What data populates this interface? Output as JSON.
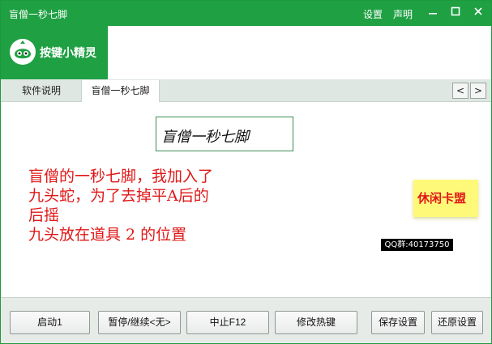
{
  "window": {
    "title": "盲僧一秒七脚",
    "links": {
      "settings": "设置",
      "statement": "声明"
    },
    "controls": {
      "minimize": "—",
      "maximize": "☐",
      "close": "✕"
    }
  },
  "brand": {
    "name": "按键小精灵",
    "color": "#1fa043"
  },
  "tabs": [
    {
      "label": "软件说明",
      "active": false
    },
    {
      "label": "盲僧一秒七脚",
      "active": true
    }
  ],
  "tab_nav": {
    "prev": "<",
    "next": ">"
  },
  "content": {
    "script_title": "盲僧一秒七脚",
    "description_lines": [
      "盲僧的一秒七脚，我加入了",
      "九头蛇，为了去掉平A后的",
      "后摇",
      "九头放在道具 2 的位置"
    ],
    "badge": "休闲卡盟",
    "qq_group": "QQ群:40173750",
    "text_color": "#e01818"
  },
  "footer_buttons": {
    "start": "启动1",
    "pause": "暂停/继续<无>",
    "stop": "中止F12",
    "hotkey": "修改热键",
    "save": "保存设置",
    "restore": "还原设置"
  }
}
